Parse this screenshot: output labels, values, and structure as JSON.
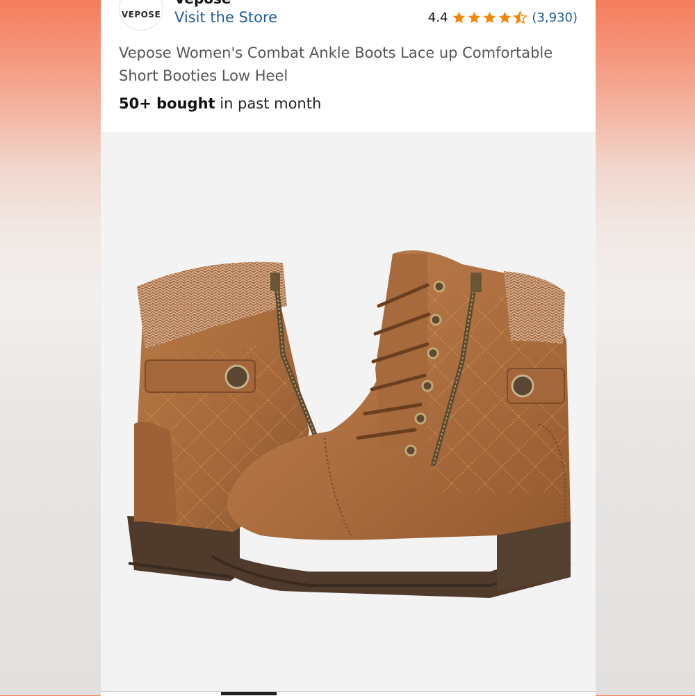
{
  "brand": {
    "logo_text": "VEPOSE",
    "name": "Vepose",
    "store_link": "Visit the Store"
  },
  "rating": {
    "value": "4.4",
    "stars": 4.5,
    "count": "(3,930)",
    "star_color": "#f08804"
  },
  "product": {
    "title": "Vepose Women's Combat Ankle Boots Lace up Comfortable Short Booties Low Heel",
    "bought_bold": "50+ bought",
    "bought_rest": " in past month"
  },
  "image": {
    "subject": "product-photo-brown-combat-ankle-boots"
  },
  "colors": {
    "link": "#1f5b9c",
    "boot_leather": "#a86a3c",
    "sole": "#4f3a2c"
  }
}
